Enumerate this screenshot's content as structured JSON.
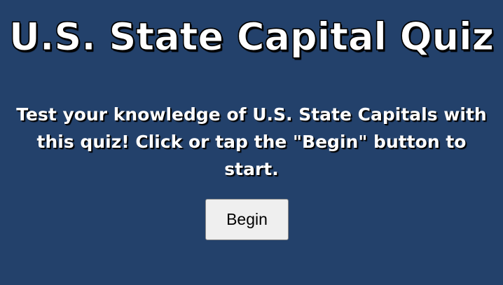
{
  "quiz": {
    "title": "U.S. State Capital Quiz",
    "intro": "Test your knowledge of U.S. State Capitals with this quiz! Click or tap the \"Begin\" button to start.",
    "begin_label": "Begin"
  },
  "colors": {
    "background": "#23416b",
    "text": "#ffffff",
    "button_bg": "#efefef"
  }
}
